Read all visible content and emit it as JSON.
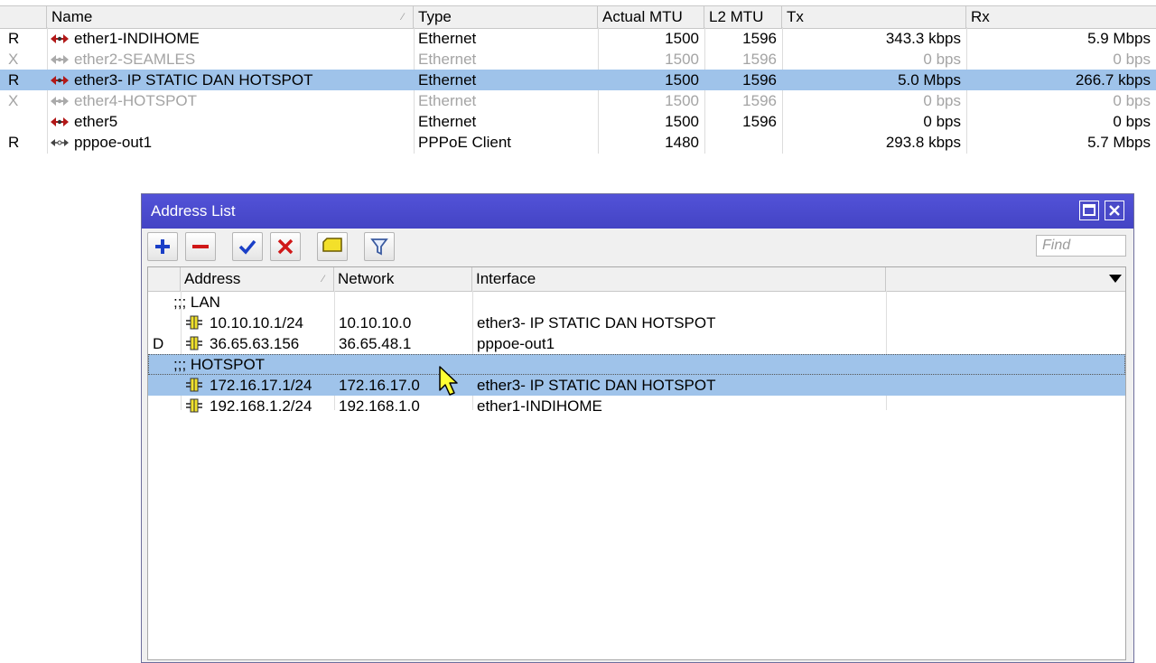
{
  "interfaces": {
    "columns": [
      "Name",
      "Type",
      "Actual MTU",
      "L2 MTU",
      "Tx",
      "Rx"
    ],
    "rows": [
      {
        "flag": "R",
        "name": "ether1-INDIHOME",
        "type": "Ethernet",
        "mtu": "1500",
        "l2mtu": "1596",
        "tx": "343.3 kbps",
        "rx": "5.9 Mbps",
        "icon": "ethernet-icon",
        "state": "normal"
      },
      {
        "flag": "X",
        "name": "ether2-SEAMLES",
        "type": "Ethernet",
        "mtu": "1500",
        "l2mtu": "1596",
        "tx": "0 bps",
        "rx": "0 bps",
        "icon": "ethernet-icon",
        "state": "disabled"
      },
      {
        "flag": "R",
        "name": "ether3- IP STATIC DAN HOTSPOT",
        "type": "Ethernet",
        "mtu": "1500",
        "l2mtu": "1596",
        "tx": "5.0 Mbps",
        "rx": "266.7 kbps",
        "icon": "ethernet-icon",
        "state": "selected"
      },
      {
        "flag": "X",
        "name": "ether4-HOTSPOT",
        "type": "Ethernet",
        "mtu": "1500",
        "l2mtu": "1596",
        "tx": "0 bps",
        "rx": "0 bps",
        "icon": "ethernet-icon",
        "state": "disabled"
      },
      {
        "flag": "",
        "name": "ether5",
        "type": "Ethernet",
        "mtu": "1500",
        "l2mtu": "1596",
        "tx": "0 bps",
        "rx": "0 bps",
        "icon": "ethernet-icon",
        "state": "normal"
      },
      {
        "flag": "R",
        "name": "pppoe-out1",
        "type": "PPPoE Client",
        "mtu": "1480",
        "l2mtu": "",
        "tx": "293.8 kbps",
        "rx": "5.7 Mbps",
        "icon": "pppoe-icon",
        "state": "normal"
      }
    ]
  },
  "address_list": {
    "title": "Address List",
    "toolbar": {
      "add": "add-icon",
      "remove": "remove-icon",
      "enable": "check-icon",
      "disable": "cross-icon",
      "comment": "comment-icon",
      "filter": "filter-icon"
    },
    "find_placeholder": "Find",
    "columns": [
      "Address",
      "Network",
      "Interface"
    ],
    "rows": [
      {
        "kind": "comment",
        "text": ";;; LAN",
        "selected": false
      },
      {
        "kind": "entry",
        "flag": "",
        "address": "10.10.10.1/24",
        "network": "10.10.10.0",
        "interface": "ether3- IP STATIC DAN HOTSPOT",
        "selected": false
      },
      {
        "kind": "entry",
        "flag": "D",
        "address": "36.65.63.156",
        "network": "36.65.48.1",
        "interface": "pppoe-out1",
        "selected": false
      },
      {
        "kind": "comment",
        "text": ";;; HOTSPOT",
        "selected": true
      },
      {
        "kind": "entry",
        "flag": "",
        "address": "172.16.17.1/24",
        "network": "172.16.17.0",
        "interface": "ether3- IP STATIC DAN HOTSPOT",
        "selected": true
      },
      {
        "kind": "entry",
        "flag": "",
        "address": "192.168.1.2/24",
        "network": "192.168.1.0",
        "interface": "ether1-INDIHOME",
        "selected": false
      }
    ]
  },
  "colors": {
    "selection": "#9fc3ea",
    "titlebar": "#4a4ac8",
    "disabled_text": "#a4a4a4"
  }
}
